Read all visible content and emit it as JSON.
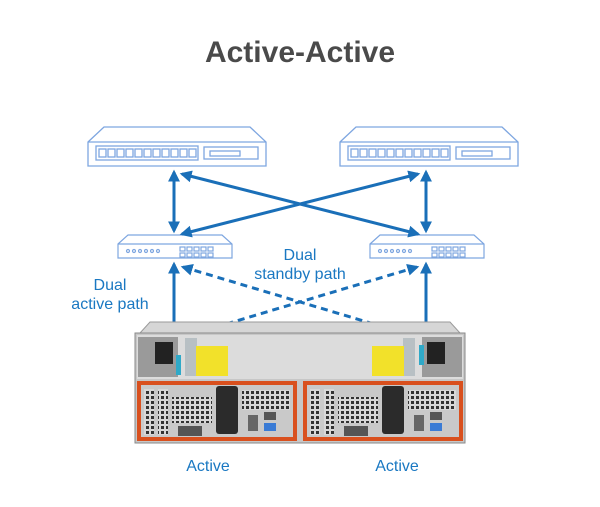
{
  "title": "Active-Active",
  "labels": {
    "dual_active": "Dual\nactive path",
    "dual_standby": "Dual\nstandby path",
    "left_controller": "Active",
    "right_controller": "Active"
  },
  "colors": {
    "accent": "#1a6fb8",
    "outline": "#7ea6e0",
    "title": "#4a4a4a",
    "chassis_orange": "#d9501e",
    "label_yellow": "#f2e12a"
  },
  "nodes": [
    {
      "id": "server-left",
      "type": "server"
    },
    {
      "id": "server-right",
      "type": "server"
    },
    {
      "id": "switch-left",
      "type": "switch"
    },
    {
      "id": "switch-right",
      "type": "switch"
    },
    {
      "id": "nas-enclosure",
      "type": "storage",
      "controllers": [
        "left",
        "right"
      ]
    }
  ],
  "edges": [
    {
      "from": "server-left",
      "to": "switch-left",
      "style": "solid"
    },
    {
      "from": "server-left",
      "to": "switch-right",
      "style": "solid"
    },
    {
      "from": "server-right",
      "to": "switch-left",
      "style": "solid"
    },
    {
      "from": "server-right",
      "to": "switch-right",
      "style": "solid"
    },
    {
      "from": "switch-left",
      "to": "controller-left",
      "style": "solid"
    },
    {
      "from": "switch-right",
      "to": "controller-right",
      "style": "solid"
    },
    {
      "from": "switch-left",
      "to": "controller-right",
      "style": "dashed"
    },
    {
      "from": "switch-right",
      "to": "controller-left",
      "style": "dashed"
    }
  ]
}
